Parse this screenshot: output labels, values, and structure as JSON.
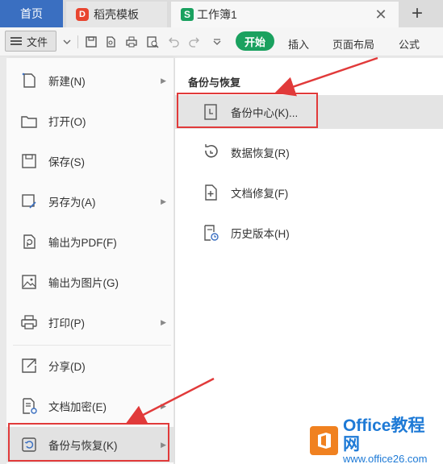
{
  "tabs": {
    "home": "首页",
    "template": "稻壳模板",
    "sheet": "工作簿1",
    "template_logo": "D",
    "sheet_logo": "S"
  },
  "toolbar": {
    "file_label": "文件",
    "ribbon_tabs": [
      "开始",
      "插入",
      "页面布局",
      "公式"
    ]
  },
  "left_menu": {
    "items": [
      {
        "label": "新建(N)",
        "icon": "new-doc-icon",
        "has_submenu": true
      },
      {
        "label": "打开(O)",
        "icon": "folder-icon",
        "has_submenu": false
      },
      {
        "label": "保存(S)",
        "icon": "save-icon",
        "has_submenu": false
      },
      {
        "label": "另存为(A)",
        "icon": "save-as-icon",
        "has_submenu": true
      },
      {
        "label": "输出为PDF(F)",
        "icon": "pdf-icon",
        "has_submenu": false
      },
      {
        "label": "输出为图片(G)",
        "icon": "image-icon",
        "has_submenu": false
      },
      {
        "label": "打印(P)",
        "icon": "print-icon",
        "has_submenu": true
      },
      {
        "label": "分享(D)",
        "icon": "share-icon",
        "has_submenu": false
      },
      {
        "label": "文档加密(E)",
        "icon": "encrypt-icon",
        "has_submenu": true
      },
      {
        "label": "备份与恢复(K)",
        "icon": "backup-icon",
        "has_submenu": true,
        "active": true
      }
    ]
  },
  "submenu": {
    "header": "备份与恢复",
    "items": [
      {
        "label": "备份中心(K)...",
        "icon": "backup-center-icon",
        "active": true
      },
      {
        "label": "数据恢复(R)",
        "icon": "data-recovery-icon"
      },
      {
        "label": "文档修复(F)",
        "icon": "doc-repair-icon"
      },
      {
        "label": "历史版本(H)",
        "icon": "history-icon"
      }
    ]
  },
  "watermark": {
    "title": "Office教程网",
    "url": "www.office26.com"
  },
  "colors": {
    "accent_blue": "#3a6fc1",
    "start_green": "#1aa15f",
    "highlight_red": "#e13a3a",
    "watermark_orange": "#f08120"
  }
}
